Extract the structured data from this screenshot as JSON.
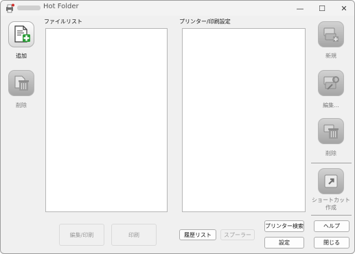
{
  "window": {
    "title": "Hot Folder",
    "controls": {
      "minimize": "—",
      "maximize": "☐",
      "close": "✕"
    }
  },
  "left_sidebar": {
    "add_label": "追加",
    "delete_label": "削除"
  },
  "file_list": {
    "label": "ファイルリスト"
  },
  "printer_settings": {
    "label": "プリンター/印刷設定"
  },
  "right_sidebar": {
    "new_label": "新規",
    "edit_label": "編集...",
    "delete_label": "削除",
    "shortcut_label": "ショートカット作成"
  },
  "bottom": {
    "edit_print": "編集/印刷",
    "print": "印刷",
    "history": "履歴リスト",
    "spooler": "スプーラー",
    "printer_search": "プリンター検索",
    "settings": "設定",
    "help": "ヘルプ",
    "close": "閉じる"
  },
  "colors": {
    "accent_green": "#2e9d3a",
    "disabled_gray": "#a9a9a9"
  }
}
